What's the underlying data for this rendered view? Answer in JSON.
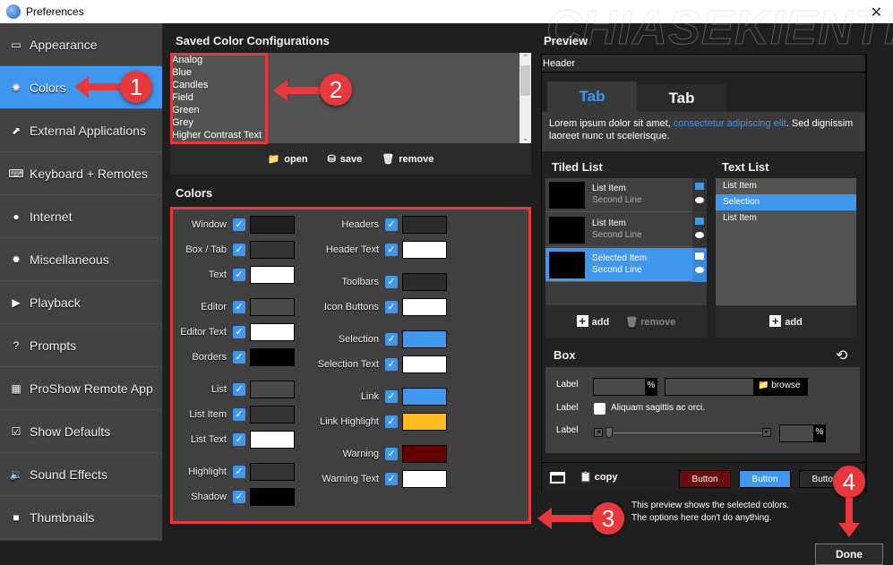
{
  "window": {
    "title": "Preferences",
    "close_icon": "close-icon"
  },
  "sidebar": {
    "items": [
      {
        "label": "Appearance",
        "icon": "appearance-icon",
        "glyph": "▭"
      },
      {
        "label": "Colors",
        "icon": "colors-icon",
        "glyph": "✺",
        "active": true
      },
      {
        "label": "External Applications",
        "icon": "external-app-icon",
        "glyph": "⬈"
      },
      {
        "label": "Keyboard + Remotes",
        "icon": "keyboard-icon",
        "glyph": "⌨"
      },
      {
        "label": "Internet",
        "icon": "globe-icon",
        "glyph": "●"
      },
      {
        "label": "Miscellaneous",
        "icon": "gear-icon",
        "glyph": "✹"
      },
      {
        "label": "Playback",
        "icon": "play-icon",
        "glyph": "▶"
      },
      {
        "label": "Prompts",
        "icon": "question-icon",
        "glyph": "?"
      },
      {
        "label": "ProShow Remote App",
        "icon": "remote-icon",
        "glyph": "▦"
      },
      {
        "label": "Show Defaults",
        "icon": "checkbox-icon",
        "glyph": "☑"
      },
      {
        "label": "Sound Effects",
        "icon": "speaker-icon",
        "glyph": "🔉"
      },
      {
        "label": "Thumbnails",
        "icon": "thumbnail-icon",
        "glyph": "■"
      }
    ]
  },
  "saved": {
    "title": "Saved Color Configurations",
    "items": [
      "Analog",
      "Blue",
      "Candles",
      "Field",
      "Green",
      "Grey",
      "Higher Contrast Text"
    ],
    "open_label": "open",
    "save_label": "save",
    "remove_label": "remove"
  },
  "colors": {
    "title": "Colors",
    "left": [
      {
        "label": "Window",
        "checked": true,
        "color": "#1f1f1f"
      },
      {
        "label": "Box / Tab",
        "checked": true,
        "color": "#353535"
      },
      {
        "label": "Text",
        "checked": true,
        "color": "#ffffff"
      },
      {
        "label": "Editor",
        "checked": true,
        "color": "#4a4a4a"
      },
      {
        "label": "Editor Text",
        "checked": true,
        "color": "#ffffff"
      },
      {
        "label": "Borders",
        "checked": true,
        "color": "#000000"
      },
      {
        "label": "List",
        "checked": true,
        "color": "#4a4a4a"
      },
      {
        "label": "List Item",
        "checked": true,
        "color": "#353535"
      },
      {
        "label": "List Text",
        "checked": true,
        "color": "#ffffff"
      },
      {
        "label": "Highlight",
        "checked": true,
        "color": "#353535"
      },
      {
        "label": "Shadow",
        "checked": true,
        "color": "#000000"
      }
    ],
    "right": [
      {
        "label": "Headers",
        "checked": true,
        "color": "#2b2b2b"
      },
      {
        "label": "Header Text",
        "checked": true,
        "color": "#ffffff"
      },
      {
        "label": "Toolbars",
        "checked": true,
        "color": "#2b2b2b"
      },
      {
        "label": "Icon Buttons",
        "checked": true,
        "color": "#ffffff"
      },
      {
        "label": "Selection",
        "checked": true,
        "color": "#3f97ee"
      },
      {
        "label": "Selection Text",
        "checked": true,
        "color": "#ffffff"
      },
      {
        "label": "Link",
        "checked": true,
        "color": "#3f97ee"
      },
      {
        "label": "Link Highlight",
        "checked": true,
        "color": "#fdbd1f"
      },
      {
        "label": "Warning",
        "checked": true,
        "color": "#660000"
      },
      {
        "label": "Warning Text",
        "checked": true,
        "color": "#ffffff"
      }
    ]
  },
  "preview": {
    "title": "Preview",
    "header": "Header",
    "tabs": [
      "Tab",
      "Tab"
    ],
    "body_pre": "Lorem ipsum dolor sit amet, ",
    "body_link": "consectetur adipiscing elit",
    "body_post": ". Sed dignissim laoreet nunc ut scelerisque.",
    "tiled_title": "Tiled List",
    "tiled_items": [
      {
        "line1": "List Item",
        "line2": "Second Line"
      },
      {
        "line1": "List Item",
        "line2": "Second Line"
      },
      {
        "line1": "Selected Item",
        "line2": "Second Line",
        "selected": true
      }
    ],
    "tiled_add": "add",
    "tiled_remove": "remove",
    "text_title": "Text List",
    "text_items": [
      {
        "label": "List Item"
      },
      {
        "label": "Selection",
        "selected": true
      },
      {
        "label": "List Item"
      }
    ],
    "text_add": "add",
    "box_title": "Box",
    "box_label1": "Label",
    "box_label2": "Label",
    "box_label3": "Label",
    "pct": "%",
    "browse": "browse",
    "checkbox_text": "Aliquam sagittis ac orci.",
    "copy_label": "copy",
    "buttons": [
      "Button",
      "Button",
      "Button"
    ],
    "note_line1": "This preview shows the selected colors.",
    "note_line2": "The options here don't do anything."
  },
  "done_label": "Done",
  "annotations": [
    "1",
    "2",
    "3",
    "4"
  ],
  "watermark": "CHIASEKIENTHUC"
}
